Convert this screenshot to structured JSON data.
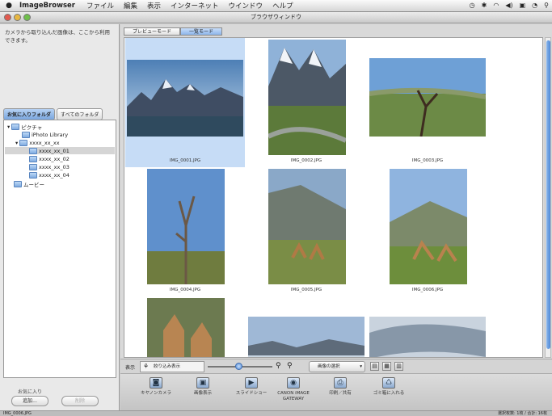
{
  "menubar": {
    "app_name": "ImageBrowser",
    "items": [
      "ファイル",
      "編集",
      "表示",
      "インターネット",
      "ウインドウ",
      "ヘルプ"
    ],
    "status_icons": [
      "clock-icon",
      "bluetooth-icon",
      "wifi-icon",
      "volume-icon",
      "keyboard-icon",
      "time-machine-icon",
      "spotlight-icon"
    ]
  },
  "window": {
    "title": "ブラウザウィンドウ"
  },
  "left_pane": {
    "info_text": "カメラから取り込んだ画像は、ここから利用できます。",
    "tabs": [
      "お気に入りフォルダ",
      "すべてのフォルダ"
    ],
    "tree": [
      {
        "label": "ピクチャ",
        "level": 0,
        "expanded": true
      },
      {
        "label": "iPhoto Library",
        "level": 1
      },
      {
        "label": "xxxx_xx_xx",
        "level": 1,
        "expanded": true
      },
      {
        "label": "xxxx_xx_01",
        "level": 2,
        "selected": true
      },
      {
        "label": "xxxx_xx_02",
        "level": 2
      },
      {
        "label": "xxxx_xx_03",
        "level": 2
      },
      {
        "label": "xxxx_xx_04",
        "level": 2
      },
      {
        "label": "ムービー",
        "level": 0
      }
    ],
    "favorites_label": "お気に入り",
    "add_button": "追加...",
    "delete_button": "削除"
  },
  "view_tabs": [
    "プレビューモード",
    "一覧モード"
  ],
  "active_view_tab": 1,
  "thumbnails": [
    {
      "name": "IMG_0001.JPG",
      "selected": true
    },
    {
      "name": "IMG_0002.JPG"
    },
    {
      "name": "IMG_0003.JPG"
    },
    {
      "name": "IMG_0004.JPG"
    },
    {
      "name": "IMG_0005.JPG"
    },
    {
      "name": "IMG_0006.JPG"
    },
    {
      "name": ""
    },
    {
      "name": ""
    },
    {
      "name": ""
    }
  ],
  "display_controls": {
    "label": "表示",
    "filter_label": "絞り込み表示",
    "select_label": "画像の選択",
    "zoom_out_icon": "zoom-out-icon",
    "zoom_in_icon": "zoom-in-icon"
  },
  "toolbar": {
    "items": [
      {
        "label": "キヤノンカメラ",
        "icon": "camera-icon"
      },
      {
        "label": "画像表示",
        "icon": "image-view-icon"
      },
      {
        "label": "スライドショー",
        "icon": "slideshow-icon"
      },
      {
        "label": "CANON iMAGE GATEWAY",
        "icon": "gateway-icon"
      },
      {
        "label": "印刷／共有",
        "icon": "print-icon"
      },
      {
        "label": "ゴミ箱に入れる",
        "icon": "trash-icon"
      }
    ]
  },
  "statusbar": {
    "left": "IMG_0006.JPG",
    "right": "選択枚数: 1枚 / 合計: 16枚"
  }
}
